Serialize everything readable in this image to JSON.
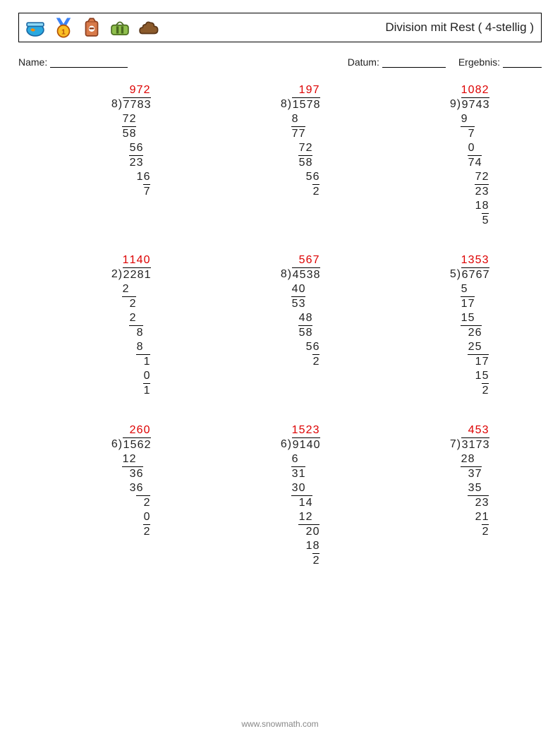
{
  "header": {
    "title": "Division mit Rest ( 4-stellig )"
  },
  "labels": {
    "name": "Name:",
    "date": "Datum:",
    "result": "Ergebnis:"
  },
  "footer": {
    "url": "www.snowmath.com"
  },
  "chart_data": {
    "type": "table",
    "description": "Long-division worksheet, 9 problems in a 3×3 grid with worked solutions",
    "problems": [
      {
        "divisor": 8,
        "dividend": 7783,
        "quotient": 972,
        "remainder": 7,
        "steps": [
          {
            "sub": "72",
            "indent": 0,
            "bar_indent": 0,
            "bar_len": 2,
            "res": "58"
          },
          {
            "sub": "56",
            "indent": 1,
            "bar_indent": 1,
            "bar_len": 2,
            "res": "23"
          },
          {
            "sub": "16",
            "indent": 2,
            "bar_indent": 3,
            "bar_len": 1,
            "res": "7"
          }
        ]
      },
      {
        "divisor": 8,
        "dividend": 1578,
        "quotient": 197,
        "remainder": 2,
        "steps": [
          {
            "sub": "8",
            "indent": 0,
            "bar_indent": 0,
            "bar_len": 2,
            "res": "77"
          },
          {
            "sub": "72",
            "indent": 1,
            "bar_indent": 1,
            "bar_len": 2,
            "res": "58"
          },
          {
            "sub": "56",
            "indent": 2,
            "bar_indent": 3,
            "bar_len": 1,
            "res": "2"
          }
        ]
      },
      {
        "divisor": 9,
        "dividend": 9743,
        "quotient": 1082,
        "remainder": 5,
        "steps": [
          {
            "sub": "9",
            "indent": 0,
            "bar_indent": 0,
            "bar_len": 2,
            "res": "7"
          },
          {
            "sub": "0",
            "indent": 1,
            "bar_indent": 1,
            "bar_len": 2,
            "res": "74"
          },
          {
            "sub": "72",
            "indent": 2,
            "bar_indent": 2,
            "bar_len": 2,
            "res": "23"
          },
          {
            "sub": "18",
            "indent": 2,
            "bar_indent": 3,
            "bar_len": 1,
            "res": "5"
          }
        ]
      },
      {
        "divisor": 2,
        "dividend": 2281,
        "quotient": 1140,
        "remainder": 1,
        "steps": [
          {
            "sub": "2",
            "indent": 0,
            "bar_indent": 0,
            "bar_len": 2,
            "res": "2"
          },
          {
            "sub": "2",
            "indent": 1,
            "bar_indent": 1,
            "bar_len": 2,
            "res": "8"
          },
          {
            "sub": "8",
            "indent": 2,
            "bar_indent": 2,
            "bar_len": 2,
            "res": "1"
          },
          {
            "sub": "0",
            "indent": 3,
            "bar_indent": 3,
            "bar_len": 1,
            "res": "1"
          }
        ]
      },
      {
        "divisor": 8,
        "dividend": 4538,
        "quotient": 567,
        "remainder": 2,
        "steps": [
          {
            "sub": "40",
            "indent": 0,
            "bar_indent": 0,
            "bar_len": 2,
            "res": "53"
          },
          {
            "sub": "48",
            "indent": 1,
            "bar_indent": 1,
            "bar_len": 2,
            "res": "58"
          },
          {
            "sub": "56",
            "indent": 2,
            "bar_indent": 3,
            "bar_len": 1,
            "res": "2"
          }
        ]
      },
      {
        "divisor": 5,
        "dividend": 6767,
        "quotient": 1353,
        "remainder": 2,
        "steps": [
          {
            "sub": "5",
            "indent": 0,
            "bar_indent": 0,
            "bar_len": 2,
            "res": "17"
          },
          {
            "sub": "15",
            "indent": 0,
            "bar_indent": 0,
            "bar_len": 3,
            "res": "26"
          },
          {
            "sub": "25",
            "indent": 1,
            "bar_indent": 1,
            "bar_len": 3,
            "res": "17"
          },
          {
            "sub": "15",
            "indent": 2,
            "bar_indent": 3,
            "bar_len": 1,
            "res": "2"
          }
        ]
      },
      {
        "divisor": 6,
        "dividend": 1562,
        "quotient": 260,
        "remainder": 2,
        "steps": [
          {
            "sub": "12",
            "indent": 0,
            "bar_indent": 0,
            "bar_len": 3,
            "res": "36"
          },
          {
            "sub": "36",
            "indent": 1,
            "bar_indent": 2,
            "bar_len": 2,
            "res": "2"
          },
          {
            "sub": "0",
            "indent": 3,
            "bar_indent": 3,
            "bar_len": 1,
            "res": "2"
          }
        ]
      },
      {
        "divisor": 6,
        "dividend": 9140,
        "quotient": 1523,
        "remainder": 2,
        "steps": [
          {
            "sub": "6",
            "indent": 0,
            "bar_indent": 0,
            "bar_len": 2,
            "res": "31"
          },
          {
            "sub": "30",
            "indent": 0,
            "bar_indent": 0,
            "bar_len": 3,
            "res": "14"
          },
          {
            "sub": "12",
            "indent": 1,
            "bar_indent": 1,
            "bar_len": 3,
            "res": "20"
          },
          {
            "sub": "18",
            "indent": 2,
            "bar_indent": 3,
            "bar_len": 1,
            "res": "2"
          }
        ]
      },
      {
        "divisor": 7,
        "dividend": 3173,
        "quotient": 453,
        "remainder": 2,
        "steps": [
          {
            "sub": "28",
            "indent": 0,
            "bar_indent": 0,
            "bar_len": 3,
            "res": "37"
          },
          {
            "sub": "35",
            "indent": 1,
            "bar_indent": 1,
            "bar_len": 3,
            "res": "23"
          },
          {
            "sub": "21",
            "indent": 2,
            "bar_indent": 3,
            "bar_len": 1,
            "res": "2"
          }
        ]
      }
    ]
  }
}
